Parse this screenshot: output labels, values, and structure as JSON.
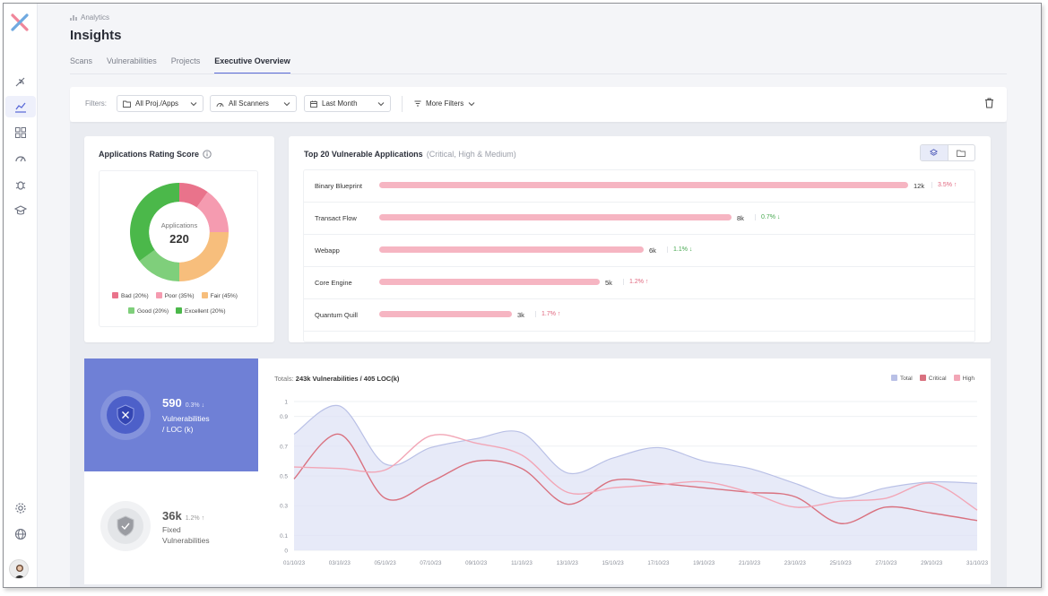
{
  "header": {
    "breadcrumb": "Analytics",
    "title": "Insights",
    "tabs": [
      {
        "label": "Scans"
      },
      {
        "label": "Vulnerabilities"
      },
      {
        "label": "Projects"
      },
      {
        "label": "Executive Overview"
      }
    ],
    "active_tab": "Executive Overview"
  },
  "filters": {
    "label": "Filters:",
    "project": "All Proj./Apps",
    "scanners": "All Scanners",
    "period": "Last Month",
    "more": "More Filters"
  },
  "rating": {
    "title": "Applications Rating Score",
    "center_label": "Applications",
    "center_value": "220",
    "legend": [
      {
        "label": "Bad (20%)",
        "value": 20,
        "color": "#e9738b"
      },
      {
        "label": "Poor (35%)",
        "value": 35,
        "color": "#f59bb0"
      },
      {
        "label": "Fair (45%)",
        "value": 45,
        "color": "#f7be7c"
      },
      {
        "label": "Good (20%)",
        "value": 20,
        "color": "#7fcf7b"
      },
      {
        "label": "Excellent (20%)",
        "value": 20,
        "color": "#4bb84a"
      }
    ]
  },
  "top_apps": {
    "title": "Top 20 Vulnerable Applications",
    "subtitle": "(Critical, High & Medium)",
    "max": 12000,
    "rows": [
      {
        "name": "Binary Blueprint",
        "value": 12000,
        "label": "12k",
        "delta": "3.5%",
        "dir": "up"
      },
      {
        "name": "Transact Flow",
        "value": 8000,
        "label": "8k",
        "delta": "0.7%",
        "dir": "down"
      },
      {
        "name": "Webapp",
        "value": 6000,
        "label": "6k",
        "delta": "1.1%",
        "dir": "down"
      },
      {
        "name": "Core Engine",
        "value": 5000,
        "label": "5k",
        "delta": "1.2%",
        "dir": "up"
      },
      {
        "name": "Quantum Quill",
        "value": 3000,
        "label": "3k",
        "delta": "1.7%",
        "dir": "up"
      }
    ]
  },
  "metrics": {
    "vuln": {
      "value": "590",
      "delta": "0.3% ↓",
      "label_line1": "Vulnerabilities",
      "label_line2": "/ LOC (k)"
    },
    "fixed": {
      "value": "36k",
      "delta": "1.2% ↑",
      "label_line1": "Fixed",
      "label_line2": "Vulnerabilities"
    }
  },
  "trend": {
    "totals_prefix": "Totals:",
    "totals_value": "243k Vulnerabilities / 405 LOC(k)"
  },
  "chart_data": {
    "type": "area",
    "x": [
      "01/10/23",
      "03/10/23",
      "05/10/23",
      "07/10/23",
      "09/10/23",
      "11/10/23",
      "13/10/23",
      "15/10/23",
      "17/10/23",
      "19/10/23",
      "21/10/23",
      "23/10/23",
      "25/10/23",
      "27/10/23",
      "29/10/23",
      "31/10/23"
    ],
    "y_ticks": [
      "1",
      "0.9",
      "0.7",
      "0.5",
      "0.3",
      "0.1",
      "0"
    ],
    "y_tick_values": [
      1,
      0.9,
      0.7,
      0.5,
      0.3,
      0.1,
      0
    ],
    "ylim": [
      0,
      1
    ],
    "series": [
      {
        "name": "Total",
        "color": "#b9c0e6",
        "values": [
          0.78,
          0.97,
          0.58,
          0.69,
          0.75,
          0.79,
          0.52,
          0.62,
          0.69,
          0.6,
          0.55,
          0.45,
          0.35,
          0.42,
          0.46,
          0.45
        ]
      },
      {
        "name": "Critical",
        "color": "#d9717f",
        "values": [
          0.48,
          0.78,
          0.35,
          0.46,
          0.6,
          0.55,
          0.31,
          0.47,
          0.45,
          0.42,
          0.39,
          0.36,
          0.18,
          0.29,
          0.25,
          0.2
        ]
      },
      {
        "name": "High",
        "color": "#f2a6b6",
        "values": [
          0.56,
          0.55,
          0.54,
          0.77,
          0.72,
          0.64,
          0.39,
          0.42,
          0.44,
          0.46,
          0.39,
          0.29,
          0.33,
          0.35,
          0.45,
          0.27
        ]
      }
    ],
    "legend_position": "top-right",
    "grid": true
  }
}
